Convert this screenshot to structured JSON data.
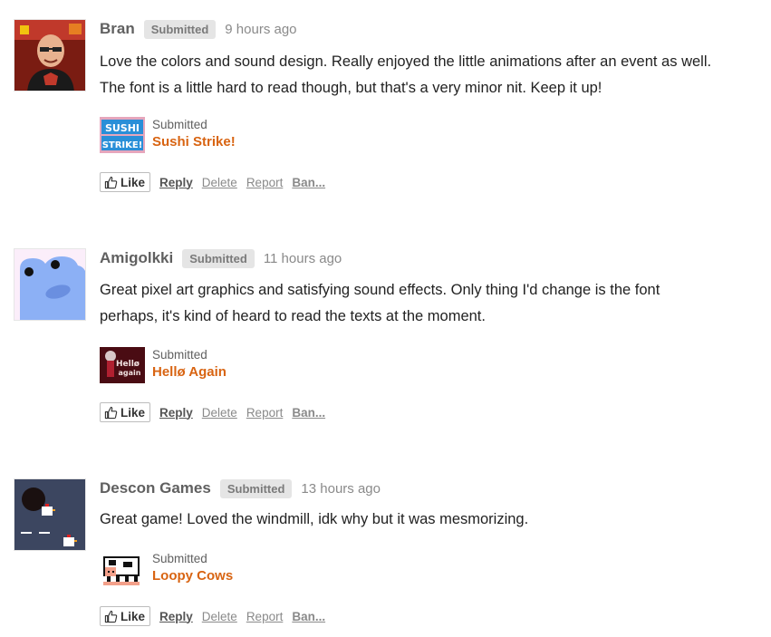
{
  "comments": [
    {
      "author": "Bran",
      "badge": "Submitted",
      "time": "9 hours ago",
      "avatar_icon": "user-photo-avatar",
      "body_lines": [
        "Love the colors and sound design. Really enjoyed the little animations after an event as well.",
        "The font is a little hard to read though, but that's a very minor nit. Keep it up!"
      ],
      "submission": {
        "status": "Submitted",
        "title": "Sushi Strike!",
        "thumb_text_1": "SUSHI",
        "thumb_text_2": "STRIKE!"
      },
      "actions": {
        "like": "Like",
        "reply": "Reply",
        "delete": "Delete",
        "report": "Report",
        "ban": "Ban..."
      }
    },
    {
      "author": "Amigolkki",
      "badge": "Submitted",
      "time": "11 hours ago",
      "avatar_icon": "blue-blob-avatar",
      "body_lines": [
        "Great pixel art graphics and satisfying sound effects. Only thing I'd change is the font",
        "perhaps, it's kind of heard to read the texts at the moment."
      ],
      "submission": {
        "status": "Submitted",
        "title": "Hellø Again",
        "thumb_text_1": "Hellø",
        "thumb_text_2": "again"
      },
      "actions": {
        "like": "Like",
        "reply": "Reply",
        "delete": "Delete",
        "report": "Report",
        "ban": "Ban..."
      }
    },
    {
      "author": "Descon Games",
      "badge": "Submitted",
      "time": "13 hours ago",
      "avatar_icon": "pixel-chicken-avatar",
      "body_lines": [
        "Great game! Loved the windmill, idk why but it was mesmorizing."
      ],
      "submission": {
        "status": "Submitted",
        "title": "Loopy Cows"
      },
      "actions": {
        "like": "Like",
        "reply": "Reply",
        "delete": "Delete",
        "report": "Report",
        "ban": "Ban..."
      }
    }
  ],
  "colors": {
    "accent_link": "#d86412",
    "badge_bg": "#e5e5e5",
    "author_text": "#606060",
    "muted_text": "#8a8a8a"
  }
}
